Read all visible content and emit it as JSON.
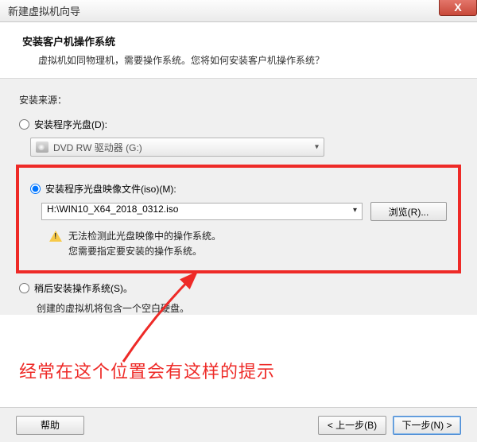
{
  "window": {
    "title": "新建虚拟机向导",
    "close": "X"
  },
  "header": {
    "title": "安装客户机操作系统",
    "subtitle": "虚拟机如同物理机，需要操作系统。您将如何安装客户机操作系统？"
  },
  "source": {
    "label": "安装来源：",
    "option_disc": "安装程序光盘(D):",
    "drive_text": "DVD RW 驱动器 (G:)",
    "option_iso": "安装程序光盘映像文件(iso)(M):",
    "iso_path": "H:\\WIN10_X64_2018_0312.iso",
    "browse": "浏览(R)...",
    "warn_line1": "无法检测此光盘映像中的操作系统。",
    "warn_line2": "您需要指定要安装的操作系统。",
    "option_later": "稍后安装操作系统(S)。",
    "later_note": "创建的虚拟机将包含一个空白硬盘。"
  },
  "annotation": "经常在这个位置会有这样的提示",
  "footer": {
    "help": "帮助",
    "back": "< 上一步(B)",
    "next": "下一步(N) >"
  }
}
